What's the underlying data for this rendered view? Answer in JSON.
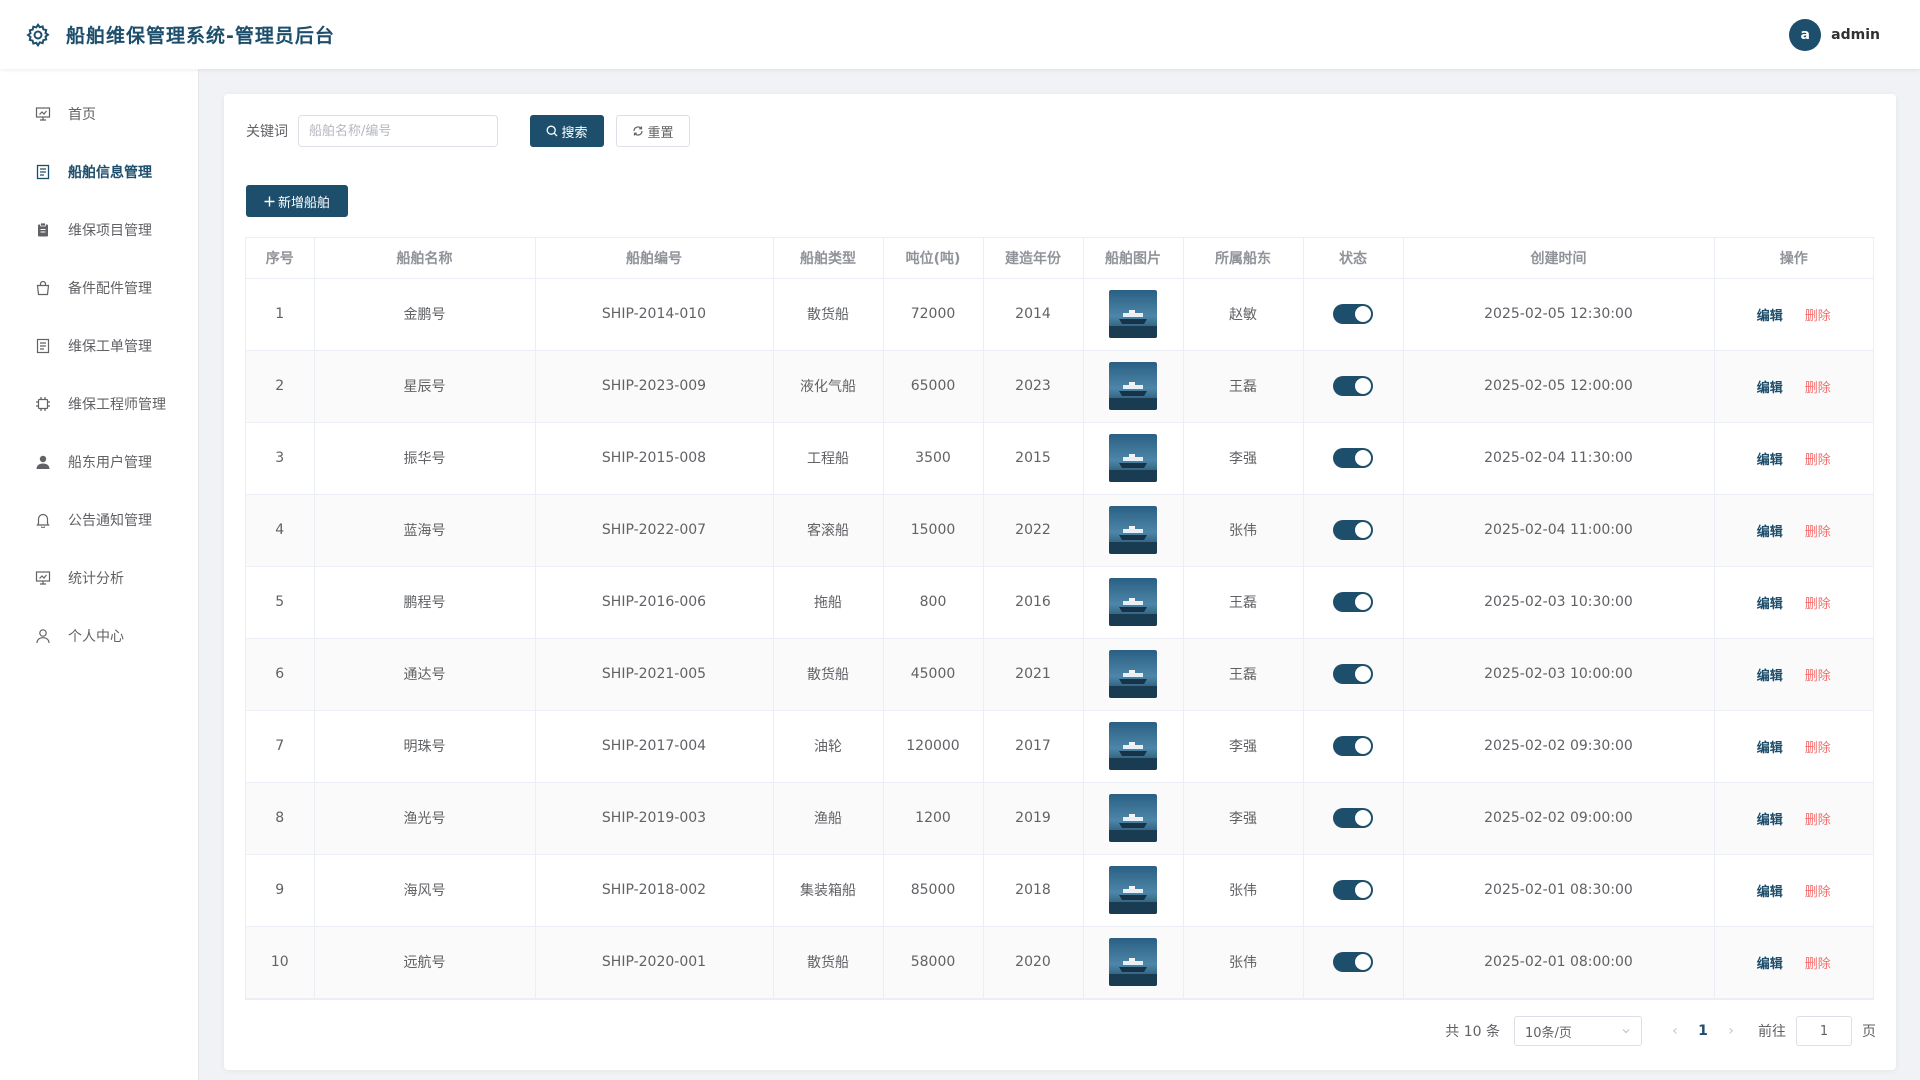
{
  "app": {
    "title": "船舶维保管理系统-管理员后台",
    "icon": "gear-icon"
  },
  "user": {
    "avatar_letter": "a",
    "name": "admin"
  },
  "sidebar": {
    "items": [
      {
        "label": "首页",
        "icon": "presentation-icon",
        "active": false
      },
      {
        "label": "船舶信息管理",
        "icon": "document-icon",
        "active": true
      },
      {
        "label": "维保项目管理",
        "icon": "clipboard-icon",
        "active": false
      },
      {
        "label": "备件配件管理",
        "icon": "bag-icon",
        "active": false
      },
      {
        "label": "维保工单管理",
        "icon": "document-icon",
        "active": false
      },
      {
        "label": "维保工程师管理",
        "icon": "cpu-icon",
        "active": false
      },
      {
        "label": "船东用户管理",
        "icon": "user-filled-icon",
        "active": false
      },
      {
        "label": "公告通知管理",
        "icon": "bell-icon",
        "active": false
      },
      {
        "label": "统计分析",
        "icon": "presentation-icon",
        "active": false
      },
      {
        "label": "个人中心",
        "icon": "user-icon",
        "active": false
      }
    ]
  },
  "search": {
    "label": "关键词",
    "value": "",
    "placeholder": "船舶名称/编号",
    "search_label": "搜索",
    "reset_label": "重置"
  },
  "toolbar": {
    "add_label": "新增船舶"
  },
  "table": {
    "columns": [
      "序号",
      "船舶名称",
      "船舶编号",
      "船舶类型",
      "吨位(吨)",
      "建造年份",
      "船舶图片",
      "所属船东",
      "状态",
      "创建时间",
      "操作"
    ],
    "edit_label": "编辑",
    "delete_label": "删除",
    "rows": [
      {
        "index": "1",
        "name": "金鹏号",
        "code": "SHIP-2014-010",
        "type": "散货船",
        "tonnage": "72000",
        "year": "2014",
        "owner": "赵敏",
        "enabled": true,
        "created": "2025-02-05 12:30:00"
      },
      {
        "index": "2",
        "name": "星辰号",
        "code": "SHIP-2023-009",
        "type": "液化气船",
        "tonnage": "65000",
        "year": "2023",
        "owner": "王磊",
        "enabled": true,
        "created": "2025-02-05 12:00:00"
      },
      {
        "index": "3",
        "name": "振华号",
        "code": "SHIP-2015-008",
        "type": "工程船",
        "tonnage": "3500",
        "year": "2015",
        "owner": "李强",
        "enabled": true,
        "created": "2025-02-04 11:30:00"
      },
      {
        "index": "4",
        "name": "蓝海号",
        "code": "SHIP-2022-007",
        "type": "客滚船",
        "tonnage": "15000",
        "year": "2022",
        "owner": "张伟",
        "enabled": true,
        "created": "2025-02-04 11:00:00"
      },
      {
        "index": "5",
        "name": "鹏程号",
        "code": "SHIP-2016-006",
        "type": "拖船",
        "tonnage": "800",
        "year": "2016",
        "owner": "王磊",
        "enabled": true,
        "created": "2025-02-03 10:30:00"
      },
      {
        "index": "6",
        "name": "通达号",
        "code": "SHIP-2021-005",
        "type": "散货船",
        "tonnage": "45000",
        "year": "2021",
        "owner": "王磊",
        "enabled": true,
        "created": "2025-02-03 10:00:00"
      },
      {
        "index": "7",
        "name": "明珠号",
        "code": "SHIP-2017-004",
        "type": "油轮",
        "tonnage": "120000",
        "year": "2017",
        "owner": "李强",
        "enabled": true,
        "created": "2025-02-02 09:30:00"
      },
      {
        "index": "8",
        "name": "渔光号",
        "code": "SHIP-2019-003",
        "type": "渔船",
        "tonnage": "1200",
        "year": "2019",
        "owner": "李强",
        "enabled": true,
        "created": "2025-02-02 09:00:00"
      },
      {
        "index": "9",
        "name": "海风号",
        "code": "SHIP-2018-002",
        "type": "集装箱船",
        "tonnage": "85000",
        "year": "2018",
        "owner": "张伟",
        "enabled": true,
        "created": "2025-02-01 08:30:00"
      },
      {
        "index": "10",
        "name": "远航号",
        "code": "SHIP-2020-001",
        "type": "散货船",
        "tonnage": "58000",
        "year": "2020",
        "owner": "张伟",
        "enabled": true,
        "created": "2025-02-01 08:00:00"
      }
    ]
  },
  "pagination": {
    "total": "共 10 条",
    "page_size": "10条/页",
    "current_page": "1",
    "goto_label": "前往",
    "goto_value": "1",
    "page_suffix": "页"
  },
  "colors": {
    "primary": "#1d4e6b",
    "danger": "#f56c6c"
  }
}
